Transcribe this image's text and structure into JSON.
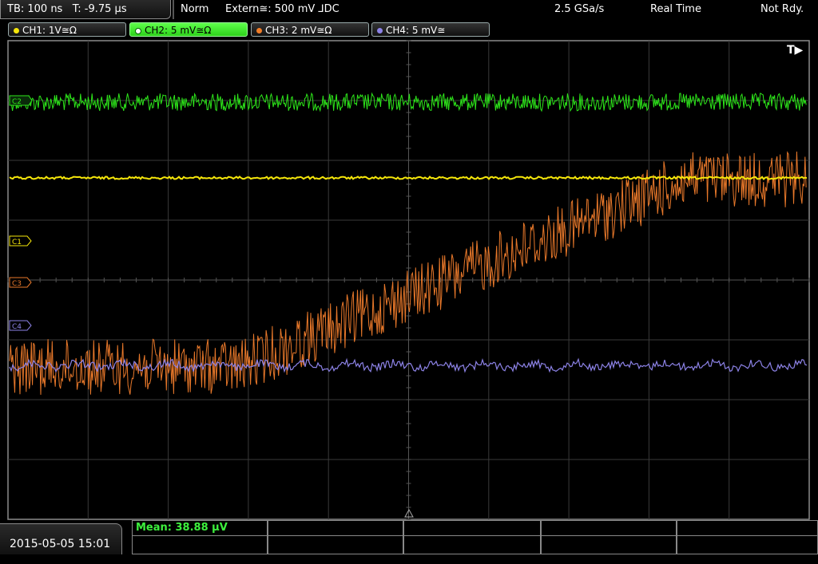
{
  "topbar": {
    "timebase": "TB: 100 ns",
    "trigger_time": "T: -9.75 µs",
    "mode": "Norm",
    "trigger_source": "Extern≅: 500 mV ⅃DC",
    "sample_rate": "2.5 GSa/s",
    "acq_mode": "Real Time",
    "status": "Not Rdy."
  },
  "channels": [
    {
      "label": "CH1: 1V≅Ω",
      "color": "#f5e60a",
      "active": false
    },
    {
      "label": "CH2: 5 mV≅Ω",
      "color": "#2de61a",
      "active": true
    },
    {
      "label": "CH3: 2 mV≅Ω",
      "color": "#f07d28",
      "active": false
    },
    {
      "label": "CH4: 5 mV≅",
      "color": "#8c82e6",
      "active": false
    }
  ],
  "markers": {
    "ch1": "C1",
    "ch2": "C2",
    "ch3": "C3",
    "ch4": "C4",
    "trigger": "T▶"
  },
  "bottom": {
    "datetime": "2015-05-05 15:01",
    "measurement": "Mean: 38.88 µV"
  },
  "colors": {
    "grid": "#3a3a3a",
    "grid_center": "#555555",
    "ch1": "#f5e60a",
    "ch2": "#2de61a",
    "ch3": "#e8782a",
    "ch4": "#8c82e6"
  }
}
